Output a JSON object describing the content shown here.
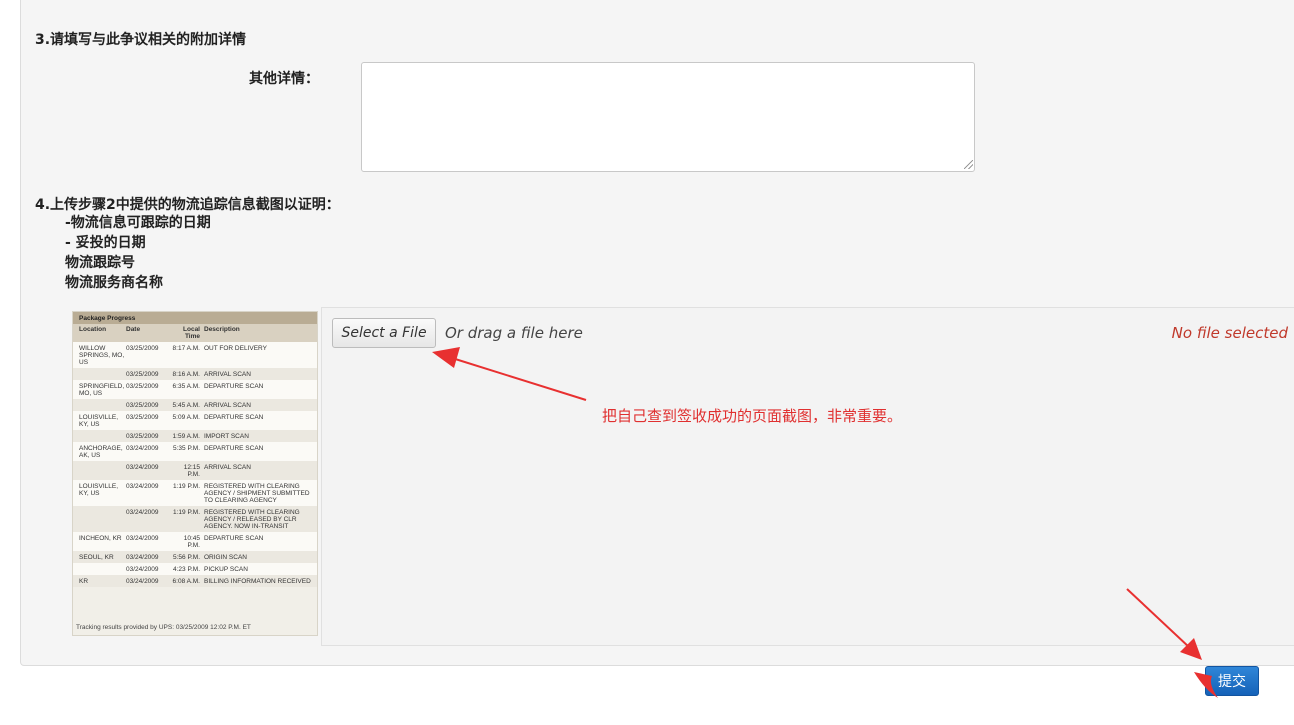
{
  "section3": {
    "title": "3.请填写与此争议相关的附加详情",
    "other_label": "其他详情：",
    "other_value": ""
  },
  "section4": {
    "title": "4.上传步骤2中提供的物流追踪信息截图以证明：",
    "items": [
      "-物流信息可跟踪的日期",
      "- 妥投的日期",
      "物流跟踪号",
      "物流服务商名称"
    ]
  },
  "example": {
    "title": "Package Progress",
    "headers": [
      "Location",
      "Date",
      "Local Time",
      "Description"
    ],
    "rows": [
      [
        "WILLOW SPRINGS, MO, US",
        "03/25/2009",
        "8:17 A.M.",
        "OUT FOR DELIVERY"
      ],
      [
        "",
        "03/25/2009",
        "8:16 A.M.",
        "ARRIVAL SCAN"
      ],
      [
        "SPRINGFIELD, MO, US",
        "03/25/2009",
        "6:35 A.M.",
        "DEPARTURE SCAN"
      ],
      [
        "",
        "03/25/2009",
        "5:45 A.M.",
        "ARRIVAL SCAN"
      ],
      [
        "LOUISVILLE, KY, US",
        "03/25/2009",
        "5:09 A.M.",
        "DEPARTURE SCAN"
      ],
      [
        "",
        "03/25/2009",
        "1:59 A.M.",
        "IMPORT SCAN"
      ],
      [
        "ANCHORAGE, AK, US",
        "03/24/2009",
        "5:35 P.M.",
        "DEPARTURE SCAN"
      ],
      [
        "",
        "03/24/2009",
        "12:15 P.M.",
        "ARRIVAL SCAN"
      ],
      [
        "LOUISVILLE, KY, US",
        "03/24/2009",
        "1:19 P.M.",
        "REGISTERED WITH CLEARING AGENCY / SHIPMENT SUBMITTED TO CLEARING AGENCY"
      ],
      [
        "",
        "03/24/2009",
        "1:19 P.M.",
        "REGISTERED WITH CLEARING AGENCY / RELEASED BY CLR AGENCY. NOW IN-TRANSIT"
      ],
      [
        "INCHEON, KR",
        "03/24/2009",
        "10:45 P.M.",
        "DEPARTURE SCAN"
      ],
      [
        "SEOUL, KR",
        "03/24/2009",
        "5:56 P.M.",
        "ORIGIN SCAN"
      ],
      [
        "",
        "03/24/2009",
        "4:23 P.M.",
        "PICKUP SCAN"
      ],
      [
        "KR",
        "03/24/2009",
        "6:08 A.M.",
        "BILLING INFORMATION RECEIVED"
      ]
    ],
    "footer": "Tracking results provided by UPS:  03/25/2009 12:02 P.M.  ET"
  },
  "upload": {
    "select_label": "Select a File",
    "drag_text": "Or drag a file here",
    "status": "No file selected",
    "annotation": "把自己查到签收成功的页面截图，非常重要。"
  },
  "submit_label": "提交",
  "colors": {
    "accent": "#1a6fc9",
    "annotation": "#e03030",
    "status": "#c0392b"
  }
}
